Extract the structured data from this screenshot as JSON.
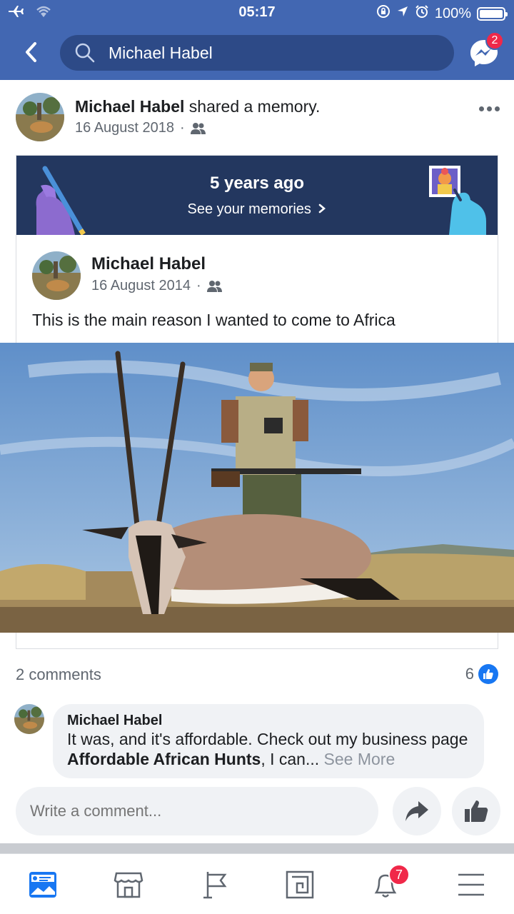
{
  "status_bar": {
    "time": "05:17",
    "battery": "100%",
    "battery_level": 1.0,
    "icons": [
      "airplane-icon",
      "wifi-icon",
      "orientation-lock-icon",
      "location-icon",
      "alarm-icon",
      "battery-icon"
    ]
  },
  "header": {
    "search_value": "Michael Habel",
    "messenger_badge": "2"
  },
  "post": {
    "author": "Michael Habel",
    "action": " shared a memory.",
    "date": "16 August 2018",
    "separator": "·",
    "audience_icon": "friends-icon"
  },
  "memory": {
    "years_ago": "5 years ago",
    "see_memories": "See your memories"
  },
  "original_post": {
    "author": "Michael Habel",
    "date": "16 August 2014",
    "separator": "·",
    "text": "This is the main reason I wanted to come to Africa"
  },
  "engagement": {
    "comments_count": "2 comments",
    "likes_count": "6"
  },
  "comment": {
    "author": "Michael Habel",
    "text_before": "It was, and it's affordable.  Check out my business page ",
    "page_name": "Affordable African Hunts",
    "text_after": ", I can... ",
    "see_more": "See More"
  },
  "composer": {
    "placeholder": "Write a comment..."
  },
  "tabbar": {
    "items": [
      "news-feed-icon",
      "marketplace-icon",
      "pages-icon",
      "groups-icon",
      "notifications-icon",
      "menu-icon"
    ],
    "notifications_badge": "7"
  },
  "colors": {
    "brand": "#4267b2",
    "memory_banner": "#23375f",
    "like_blue": "#1877f2",
    "badge_red": "#f02849"
  }
}
